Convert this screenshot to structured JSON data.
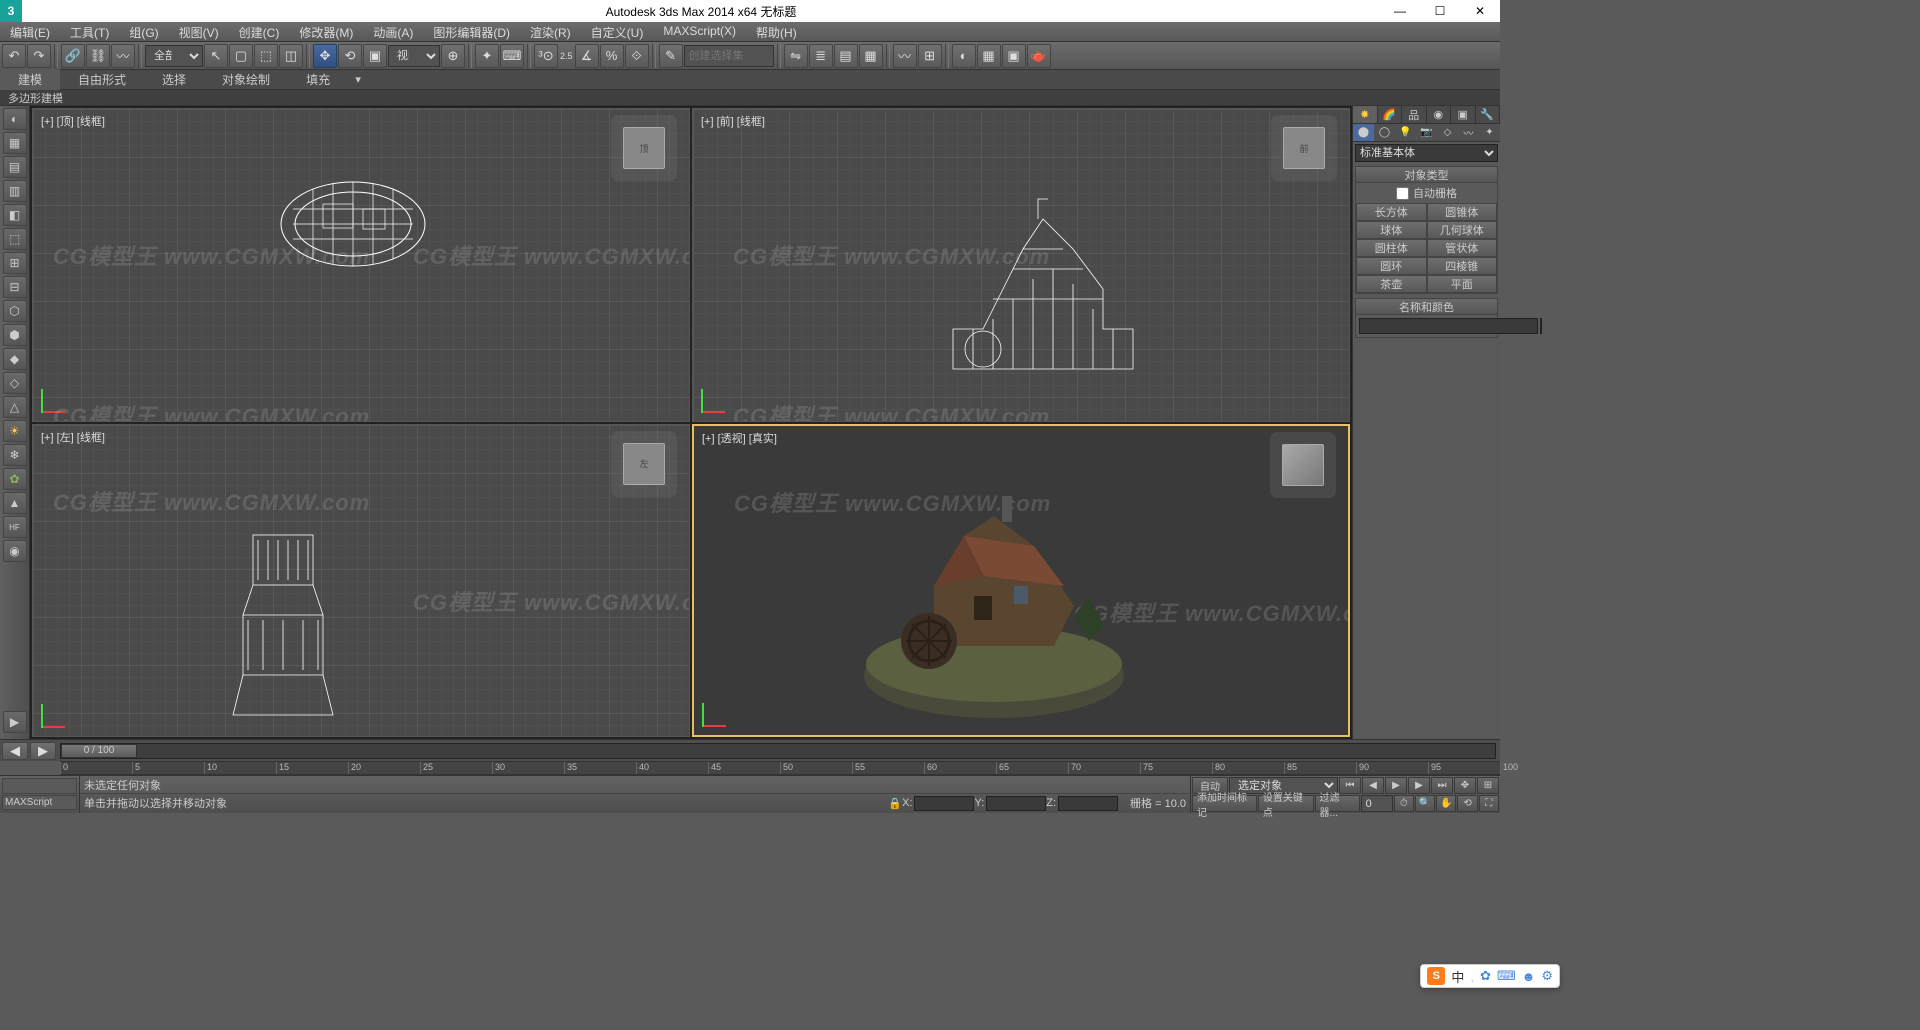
{
  "title": "Autodesk 3ds Max  2014 x64     无标题",
  "menus": [
    "编辑(E)",
    "工具(T)",
    "组(G)",
    "视图(V)",
    "创建(C)",
    "修改器(M)",
    "动画(A)",
    "图形编辑器(D)",
    "渲染(R)",
    "自定义(U)",
    "MAXScript(X)",
    "帮助(H)"
  ],
  "toolbar": {
    "selection_filter": "全部",
    "refsys": "视图",
    "angle_snap": "2.5",
    "named_sel_placeholder": "创建选择集"
  },
  "ribbon": {
    "tabs": [
      "建模",
      "自由形式",
      "选择",
      "对象绘制",
      "填充"
    ],
    "active": 0,
    "sub": "多边形建模"
  },
  "left_icons": [
    "◐",
    "▦",
    "▤",
    "▥",
    "◧",
    "⬚",
    "⊞",
    "⊟",
    "⬡",
    "⬢",
    "◆",
    "◇",
    "△",
    "☀",
    "❄",
    "✿",
    "▲",
    "HF",
    "◉"
  ],
  "viewports": [
    {
      "label": "[+] [顶] [线框]",
      "cube": "顶"
    },
    {
      "label": "[+] [前] [线框]",
      "cube": "前"
    },
    {
      "label": "[+] [左] [线框]",
      "cube": "左"
    },
    {
      "label": "[+] [透视] [真实]",
      "cube": ""
    }
  ],
  "watermark_text": "CG模型王  www.CGMXW.com",
  "command_panel": {
    "dropdown": "标准基本体",
    "rollout1": "对象类型",
    "autogrid": "自动栅格",
    "objects": [
      "长方体",
      "圆锥体",
      "球体",
      "几何球体",
      "圆柱体",
      "管状体",
      "圆环",
      "四棱锥",
      "茶壶",
      "平面"
    ],
    "rollout2": "名称和颜色"
  },
  "timeline": {
    "frame_label": "0 / 100",
    "ticks": [
      0,
      5,
      10,
      15,
      20,
      25,
      30,
      35,
      40,
      45,
      50,
      55,
      60,
      65,
      70,
      75,
      80,
      85,
      90,
      95,
      100
    ]
  },
  "status": {
    "script_label": "MAXScript",
    "prompt1": "未选定任何对象",
    "prompt2": "单击并拖动以选择并移动对象",
    "x": "",
    "y": "",
    "z": "",
    "grid": "栅格 = 10.0",
    "auto": "自动",
    "selkey": "选定对象",
    "addtag": "添加时间标记",
    "setkey": "设置关键点",
    "keyfilter": "过滤器..."
  },
  "ime": {
    "text": "中",
    "icons": [
      "✿",
      "⌨",
      "☻",
      "⚙"
    ]
  }
}
